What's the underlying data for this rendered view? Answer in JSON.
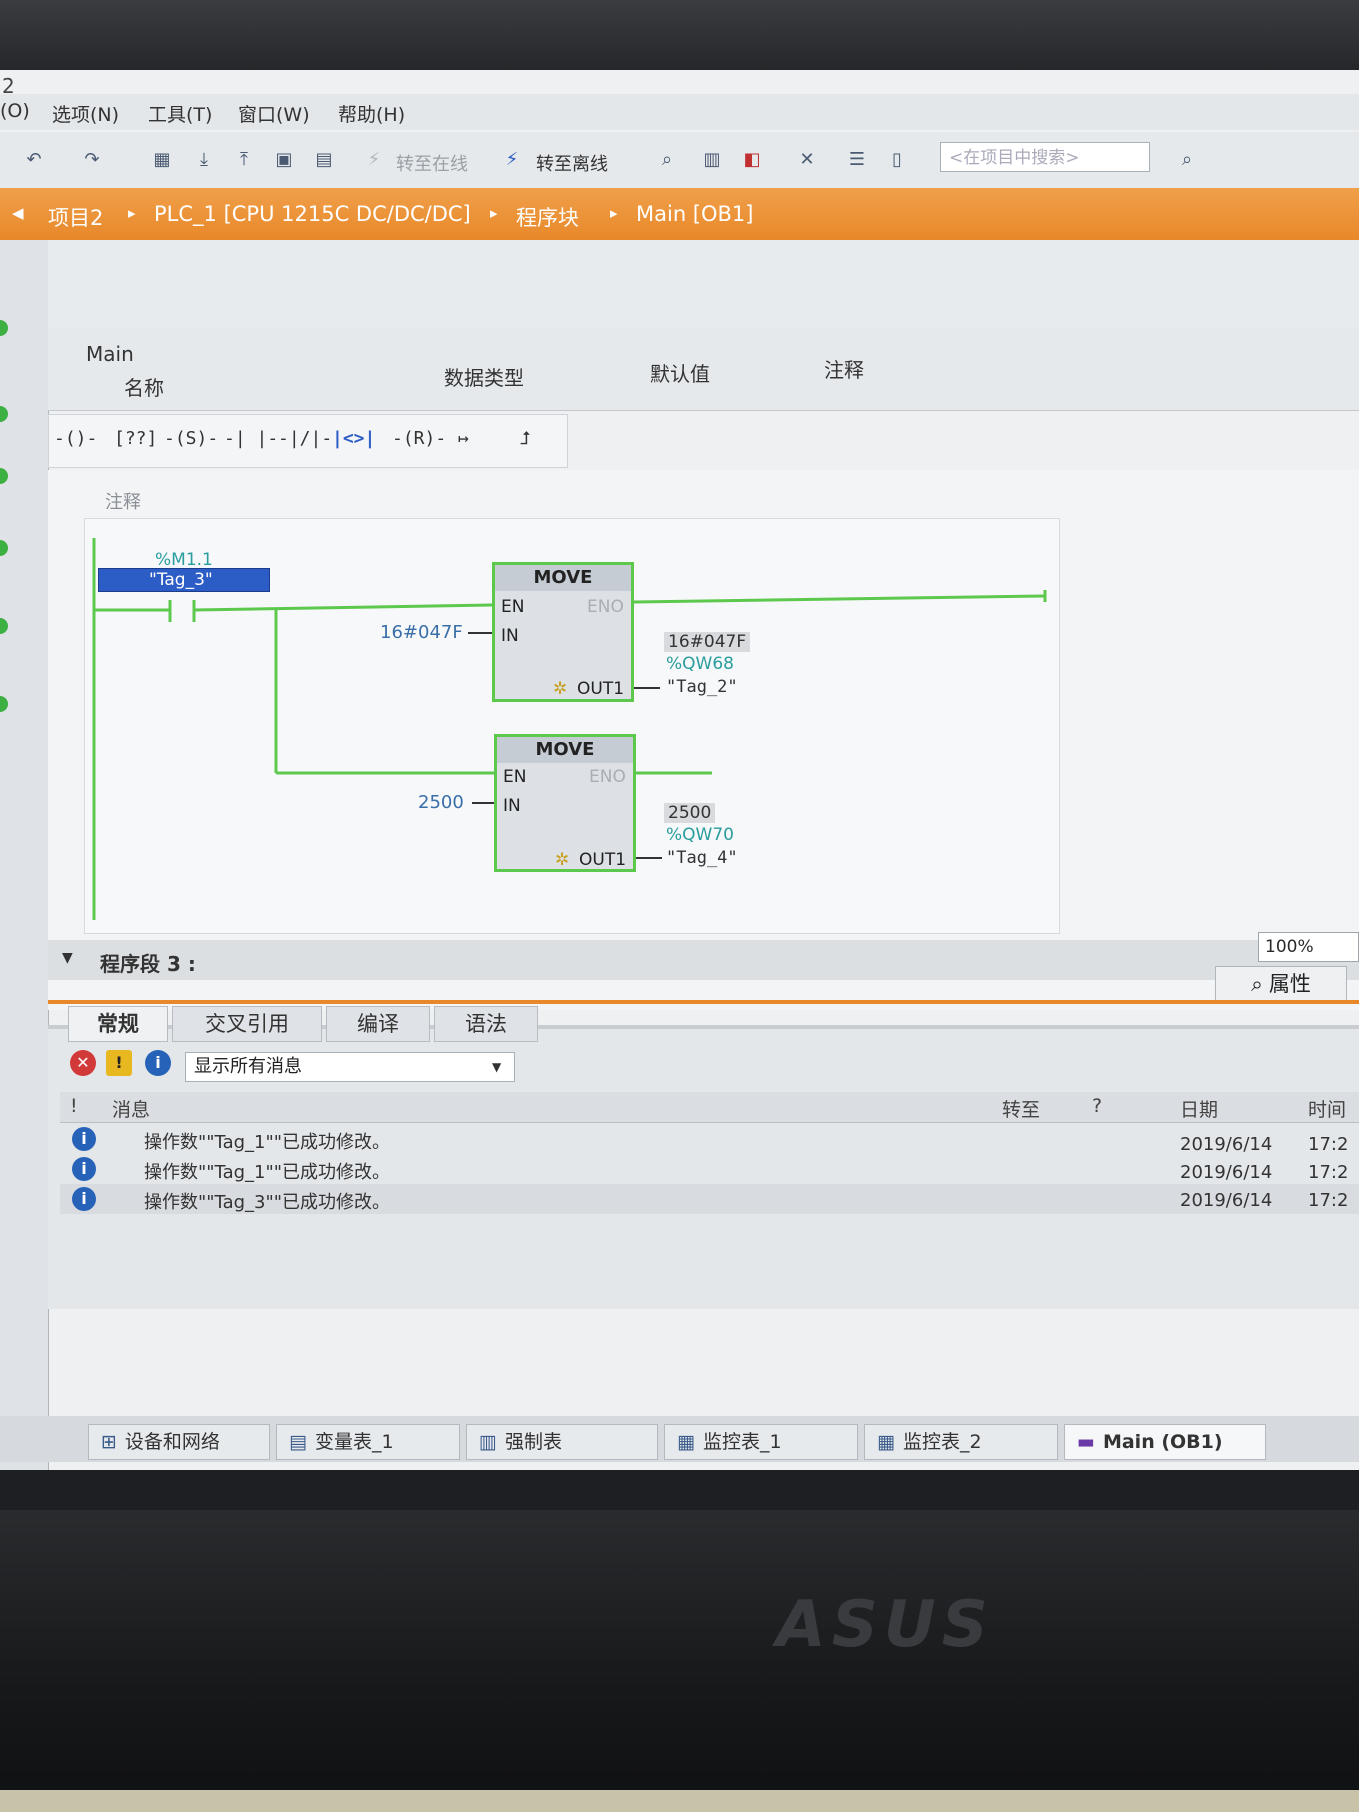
{
  "window": {
    "title_number": "2"
  },
  "menu": {
    "items": [
      "(O)",
      "选项(N)",
      "工具(T)",
      "窗口(W)",
      "帮助(H)"
    ]
  },
  "toolbar": {
    "go_online_label": "转至在线",
    "go_offline_label": "转至离线",
    "search_placeholder": "<在项目中搜索>"
  },
  "breadcrumb": [
    "项目2",
    "PLC_1 [CPU 1215C DC/DC/DC]",
    "程序块",
    "Main [OB1]"
  ],
  "interface": {
    "block_name": "Main",
    "columns": [
      "名称",
      "数据类型",
      "默认值",
      "注释"
    ]
  },
  "palette": [
    "-()-",
    "[??]",
    "-(S)-",
    "-| |-",
    "-|/|-",
    "|<>|",
    "-(R)-",
    "↦",
    "⮥"
  ],
  "network": {
    "comment_label": "注释",
    "contact": {
      "address": "%M1.1",
      "tag": "\"Tag_3\""
    },
    "move_blocks": [
      {
        "title": "MOVE",
        "en": "EN",
        "eno": "ENO",
        "in": "IN",
        "out": "OUT1",
        "in_value": "16#047F",
        "out_value": "16#047F",
        "out_address": "%QW68",
        "out_tag": "\"Tag_2\""
      },
      {
        "title": "MOVE",
        "en": "EN",
        "eno": "ENO",
        "in": "IN",
        "out": "OUT1",
        "in_value": "2500",
        "out_value": "2500",
        "out_address": "%QW70",
        "out_tag": "\"Tag_4\""
      }
    ]
  },
  "segment3": {
    "label": "程序段 3 :"
  },
  "zoom": "100%",
  "inspector": {
    "properties_tab": "属性",
    "tabs": [
      "常规",
      "交叉引用",
      "编译",
      "语法"
    ],
    "active_tab": "常规",
    "filter": "显示所有消息",
    "columns": [
      "!",
      "消息",
      "转至",
      "?",
      "日期",
      "时间"
    ],
    "messages": [
      {
        "text": "操作数\"\"Tag_1\"\"已成功修改。",
        "date": "2019/6/14",
        "time": "17:2"
      },
      {
        "text": "操作数\"\"Tag_1\"\"已成功修改。",
        "date": "2019/6/14",
        "time": "17:2"
      },
      {
        "text": "操作数\"\"Tag_3\"\"已成功修改。",
        "date": "2019/6/14",
        "time": "17:2"
      }
    ]
  },
  "taskbar": [
    {
      "label": "设备和网络",
      "icon": "network-icon"
    },
    {
      "label": "变量表_1",
      "icon": "tag-table-icon"
    },
    {
      "label": "强制表",
      "icon": "force-table-icon"
    },
    {
      "label": "监控表_1",
      "icon": "watch-table-icon"
    },
    {
      "label": "监控表_2",
      "icon": "watch-table-icon"
    },
    {
      "label": "Main (OB1)",
      "icon": "block-icon"
    }
  ],
  "colors": {
    "accent_orange": "#e8882a",
    "power_flow_green": "#5cc94d",
    "tag_teal": "#2a9d9d",
    "selection_blue": "#2c5cc5"
  },
  "brand": "ASUS"
}
